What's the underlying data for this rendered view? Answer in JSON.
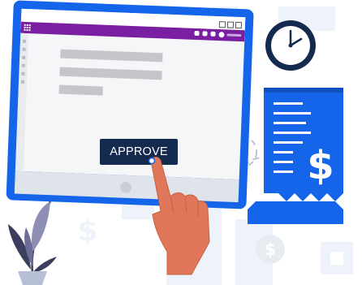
{
  "approve_button": {
    "label": "APPROVE"
  },
  "colors": {
    "primary_blue": "#1565ea",
    "purple_bar": "#7b1fa2",
    "button_navy": "#152a4f",
    "hand": "#e0775a",
    "tile": "#eef2fa"
  },
  "icons": [
    "clock-icon",
    "dollar-icon",
    "grid-icon",
    "pointer-hand",
    "plant"
  ]
}
